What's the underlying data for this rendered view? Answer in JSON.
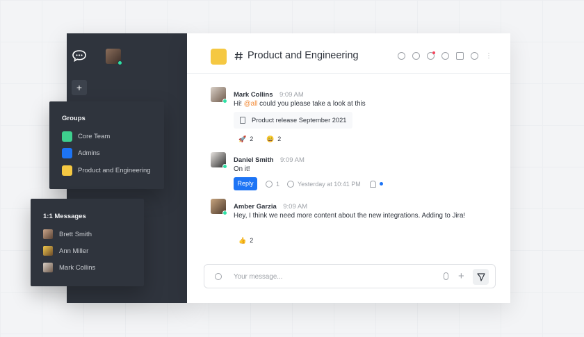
{
  "sidebar": {
    "groups_panel": {
      "title": "Groups",
      "items": [
        {
          "label": "Core Team",
          "color": "#3ecf8e"
        },
        {
          "label": "Admins",
          "color": "#1d74f5"
        },
        {
          "label": "Product and Engineering",
          "color": "#f5c842"
        }
      ]
    },
    "dm_panel": {
      "title": "1:1 Messages",
      "items": [
        {
          "label": "Brett Smith"
        },
        {
          "label": "Ann Miller"
        },
        {
          "label": "Mark Collins"
        }
      ]
    },
    "add_label": "+"
  },
  "header": {
    "title": "Product and Engineering",
    "room_color": "#f5c842",
    "icons": [
      "globe-icon",
      "info-icon",
      "threads-icon",
      "discussion-icon",
      "call-icon",
      "members-icon",
      "kebab-icon"
    ]
  },
  "messages": [
    {
      "name": "Mark Collins",
      "time": "9:09 AM",
      "text_prefix": "Hi! ",
      "mention": "@all",
      "text_suffix": " could you please take a look at this",
      "attachment": "Product release September 2021",
      "reactions": [
        {
          "emoji": "🚀",
          "count": "2"
        },
        {
          "emoji": "😄",
          "count": "2"
        }
      ]
    },
    {
      "name": "Daniel Smith",
      "time": "9:09 AM",
      "text": "On it!",
      "reply_label": "Reply",
      "reply_count": "1",
      "thread_time": "Yesterday at 10:41 PM"
    },
    {
      "name": "Amber Garzia",
      "time": "9:09 AM",
      "text": "Hey, I think we need more content about the new integrations. Adding to Jira!",
      "reactions": [
        {
          "emoji": "👍",
          "count": "2"
        }
      ]
    }
  ],
  "composer": {
    "placeholder": "Your message...",
    "plus": "+"
  },
  "kebab_glyph": "⋮"
}
